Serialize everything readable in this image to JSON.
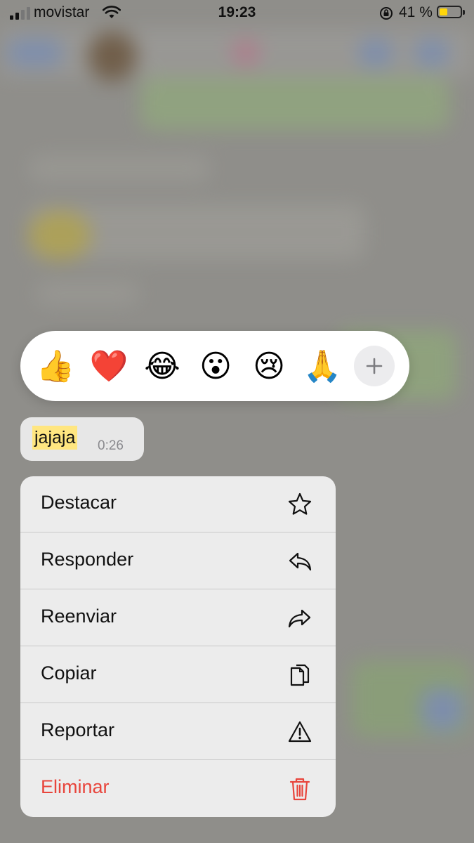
{
  "status_bar": {
    "carrier": "movistar",
    "time": "19:23",
    "battery_percent": "41 %",
    "battery_level": 0.41
  },
  "reactions": [
    {
      "name": "thumbs-up-emoji",
      "glyph": "👍"
    },
    {
      "name": "red-heart-emoji",
      "glyph": "❤️"
    },
    {
      "name": "tears-of-joy-emoji",
      "glyph": "😂"
    },
    {
      "name": "surprised-face-emoji",
      "glyph": "😮"
    },
    {
      "name": "crying-face-emoji",
      "glyph": "😢"
    },
    {
      "name": "folded-hands-emoji",
      "glyph": "🙏"
    }
  ],
  "message": {
    "text": "jajaja",
    "time": "0:26"
  },
  "menu": {
    "items": [
      {
        "label": "Destacar",
        "icon": "star-icon"
      },
      {
        "label": "Responder",
        "icon": "reply-icon"
      },
      {
        "label": "Reenviar",
        "icon": "forward-icon"
      },
      {
        "label": "Copiar",
        "icon": "copy-icon"
      },
      {
        "label": "Reportar",
        "icon": "warning-icon"
      },
      {
        "label": "Eliminar",
        "icon": "trash-icon"
      }
    ]
  },
  "colors": {
    "danger": "#e8453c",
    "highlight": "#ffe680",
    "battery_fill": "#ffd60a"
  }
}
